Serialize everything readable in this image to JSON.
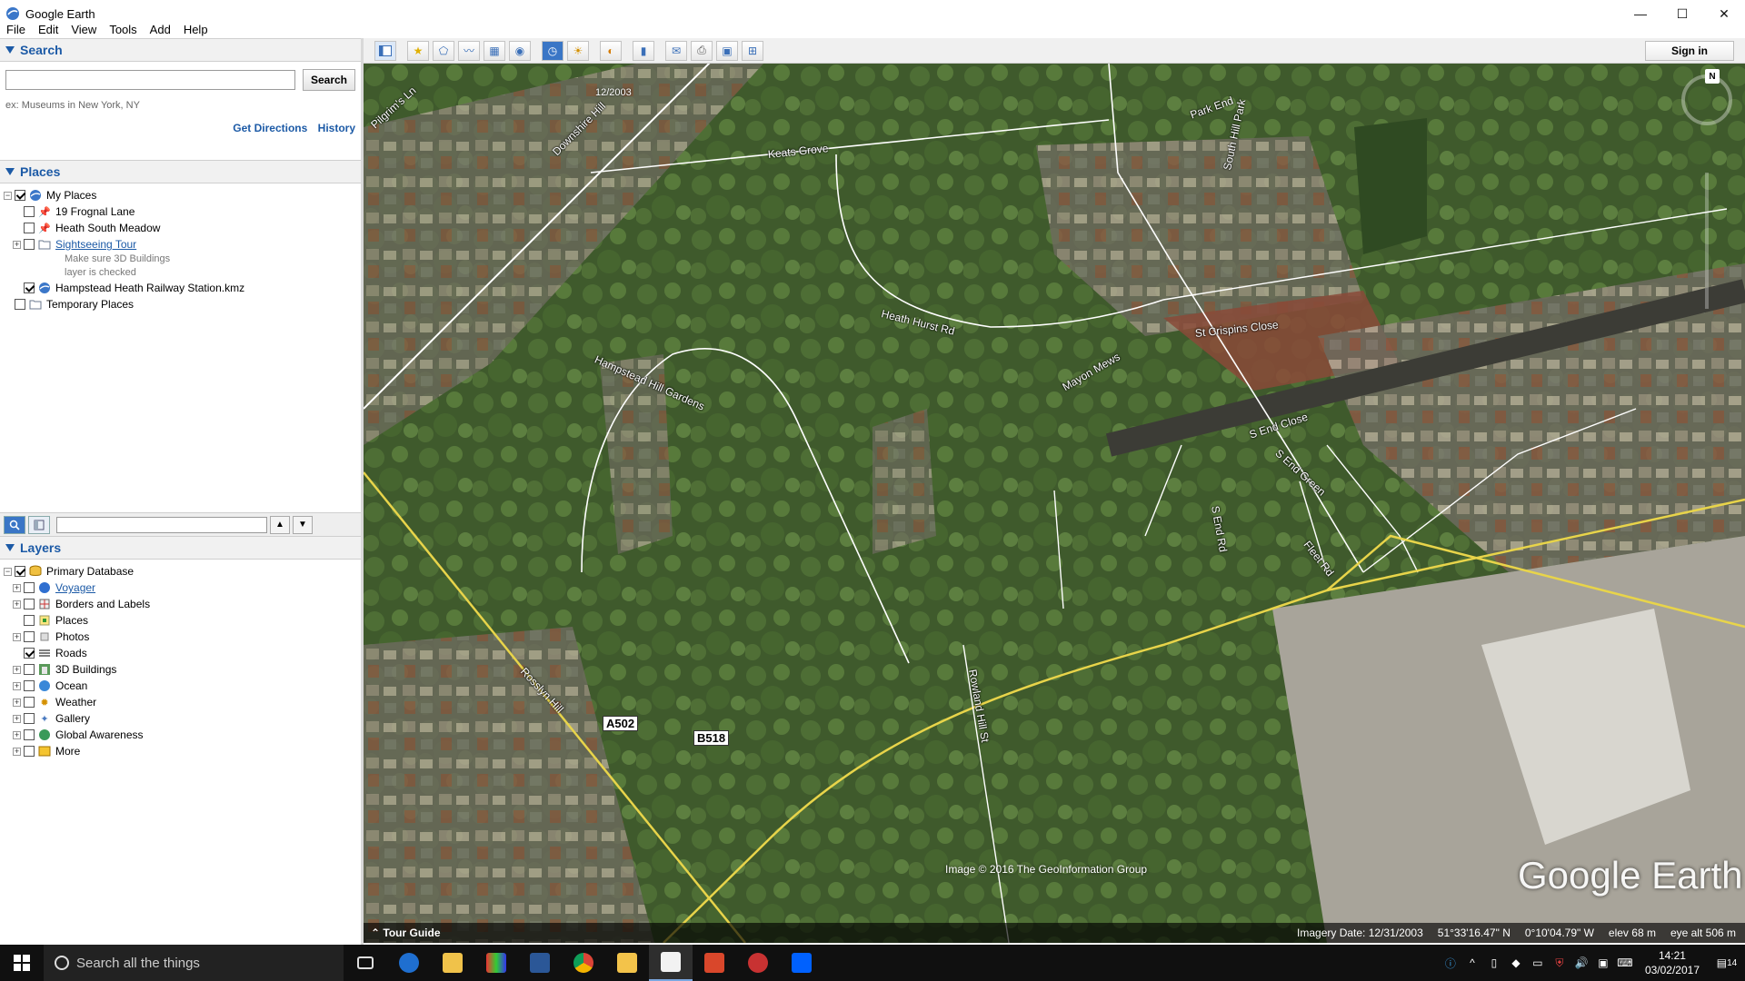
{
  "window": {
    "title": "Google Earth",
    "min": "—",
    "max": "☐",
    "close": "✕"
  },
  "menu": [
    "File",
    "Edit",
    "View",
    "Tools",
    "Add",
    "Help"
  ],
  "search": {
    "header": "Search",
    "placeholder": "",
    "button": "Search",
    "hint": "ex: Museums in New York, NY",
    "get_directions": "Get Directions",
    "history": "History"
  },
  "places": {
    "header": "Places",
    "my_places": "My Places",
    "items": [
      {
        "label": "19 Frognal Lane"
      },
      {
        "label": "Heath South Meadow"
      },
      {
        "label": "Sightseeing Tour"
      },
      {
        "label": "Hampstead Heath Railway Station.kmz"
      }
    ],
    "tour_note_1": "Make sure 3D Buildings",
    "tour_note_2": "layer is checked",
    "temporary": "Temporary Places"
  },
  "layers": {
    "header": "Layers",
    "primary": "Primary Database",
    "items": [
      {
        "label": "Voyager"
      },
      {
        "label": "Borders and Labels"
      },
      {
        "label": "Places"
      },
      {
        "label": "Photos"
      },
      {
        "label": "Roads"
      },
      {
        "label": "3D Buildings"
      },
      {
        "label": "Ocean"
      },
      {
        "label": "Weather"
      },
      {
        "label": "Gallery"
      },
      {
        "label": "Global Awareness"
      },
      {
        "label": "More"
      }
    ]
  },
  "toolbar": {
    "sign_in": "Sign in"
  },
  "map": {
    "time_slider_date": "12/2003",
    "north": "N",
    "streets": {
      "pilgrims_lane": "Pilgrim's Ln",
      "downshire_hill": "Downshire Hill",
      "keats_grove": "Keats Grove",
      "heath_hurst": "Heath Hurst Rd",
      "hampstead_hill_gardens": "Hampstead Hill Gardens",
      "rosslyn_hill": "Rosslyn Hill",
      "rowland_hill": "Rowland Hill St",
      "st_crispins": "St Crispins Close",
      "s_end_close": "S End Close",
      "s_end_green": "S End Green",
      "s_end_rd": "S End Rd",
      "fleet_rd": "Fleet Rd",
      "mayon_mews": "Mayon Mews",
      "park_end": "Park End",
      "south_hill_park": "South Hill Park"
    },
    "shields": {
      "a502": "A502",
      "b518": "B518"
    },
    "credit": "Image © 2016 The GeoInformation Group",
    "watermark": "Google Earth"
  },
  "status": {
    "tour_guide": "Tour Guide",
    "imagery_date": "Imagery Date: 12/31/2003",
    "lat": "51°33'16.47\" N",
    "lon": "0°10'04.79\" W",
    "elev": "elev   68 m",
    "eye_alt": "eye alt   506 m"
  },
  "taskbar": {
    "search_placeholder": "Search all the things",
    "time": "14:21",
    "date": "03/02/2017",
    "notification_count": "14"
  },
  "colors": {
    "accent": "#1c5aa6",
    "taskbar": "#101010",
    "road_yellow": "#e8d44a"
  }
}
